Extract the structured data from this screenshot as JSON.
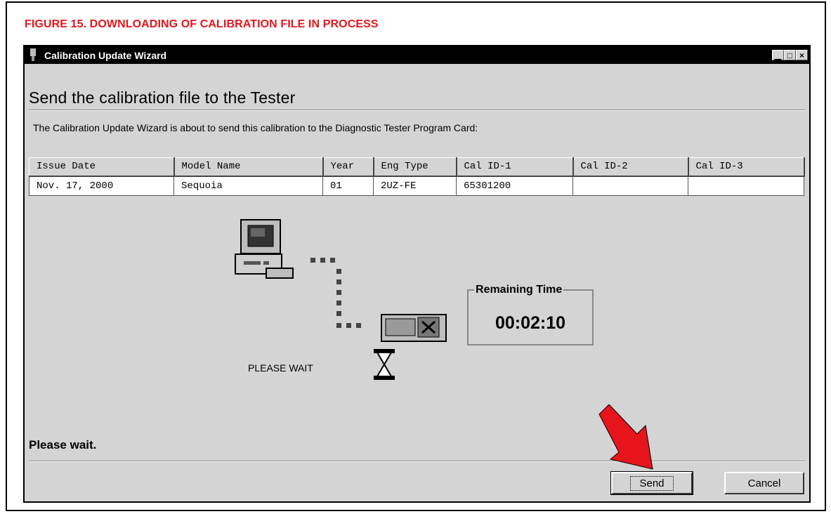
{
  "caption": "FIGURE 15.  DOWNLOADING OF CALIBRATION FILE IN PROCESS",
  "window": {
    "title": "Calibration Update Wizard",
    "controls": {
      "minimize": "▁",
      "maximize": "□",
      "close": "×"
    }
  },
  "heading": "Send the calibration file to the Tester",
  "description": "The Calibration Update Wizard is about to send this calibration to the Diagnostic Tester Program Card:",
  "table": {
    "headers": [
      "Issue Date",
      "Model Name",
      "Year",
      "Eng Type",
      "Cal ID-1",
      "Cal ID-2",
      "Cal ID-3"
    ],
    "rows": [
      [
        "Nov. 17, 2000",
        "Sequoia",
        "01",
        "2UZ-FE",
        "65301200",
        "",
        ""
      ]
    ]
  },
  "progress": {
    "wait_label": "PLEASE WAIT",
    "remaining_label": "Remaining Time",
    "remaining_value": "00:02:10"
  },
  "status": "Please wait.",
  "buttons": {
    "send": "Send",
    "cancel": "Cancel"
  },
  "icons": [
    "computer-icon",
    "tester-icon",
    "hourglass-icon",
    "pointer-arrow-icon"
  ],
  "colors": {
    "caption": "#e8141b",
    "arrow": "#e8141b",
    "window_bg": "#d4d4d4"
  }
}
